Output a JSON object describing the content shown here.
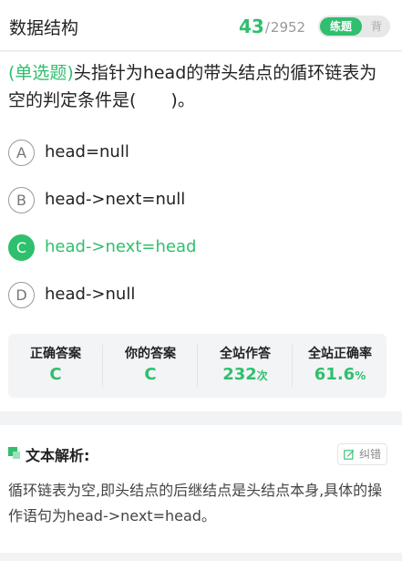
{
  "header": {
    "title": "数据结构",
    "current": "43",
    "total": "2952",
    "mode_active": "练题",
    "mode_inactive": "背"
  },
  "question": {
    "type_label": "(单选题)",
    "text": "头指针为head的带头结点的循环链表为空的判定条件是(　　)。"
  },
  "options": [
    {
      "letter": "A",
      "text": "head=null"
    },
    {
      "letter": "B",
      "text": "head->next=null"
    },
    {
      "letter": "C",
      "text": "head->next=head"
    },
    {
      "letter": "D",
      "text": "head->null"
    }
  ],
  "stats": {
    "correct_answer_label": "正确答案",
    "correct_answer_value": "C",
    "your_answer_label": "你的答案",
    "your_answer_value": "C",
    "attempts_label": "全站作答",
    "attempts_value": "232",
    "attempts_unit": "次",
    "accuracy_label": "全站正确率",
    "accuracy_value": "61.6",
    "accuracy_unit": "%"
  },
  "analysis": {
    "title": "文本解析:",
    "report_button": "纠错",
    "text": "循环链表为空,即头结点的后继结点是头结点本身,具体的操作语句为head->next=head。"
  },
  "colors": {
    "accent": "#2fbf6e",
    "background": "#f2f3f5"
  }
}
